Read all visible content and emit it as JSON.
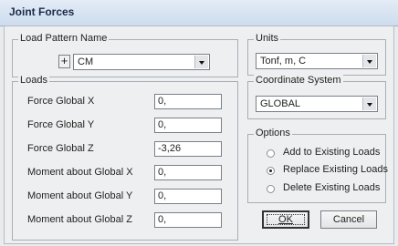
{
  "window": {
    "title": "Joint Forces"
  },
  "load_pattern": {
    "legend": "Load Pattern Name",
    "plus_label": "+",
    "value": "CM"
  },
  "units": {
    "legend": "Units",
    "value": "Tonf, m, C"
  },
  "loads": {
    "legend": "Loads",
    "rows": [
      {
        "label": "Force Global X",
        "value": "0,"
      },
      {
        "label": "Force Global Y",
        "value": "0,"
      },
      {
        "label": "Force Global Z",
        "value": "-3,26"
      },
      {
        "label": "Moment about Global X",
        "value": "0,"
      },
      {
        "label": "Moment about Global Y",
        "value": "0,"
      },
      {
        "label": "Moment about Global Z",
        "value": "0,"
      }
    ]
  },
  "coordinate_system": {
    "legend": "Coordinate System",
    "value": "GLOBAL"
  },
  "options": {
    "legend": "Options",
    "items": [
      {
        "label": "Add to Existing Loads",
        "selected": false
      },
      {
        "label": "Replace Existing Loads",
        "selected": true
      },
      {
        "label": "Delete Existing Loads",
        "selected": false
      }
    ]
  },
  "buttons": {
    "ok": "OK",
    "cancel": "Cancel"
  }
}
